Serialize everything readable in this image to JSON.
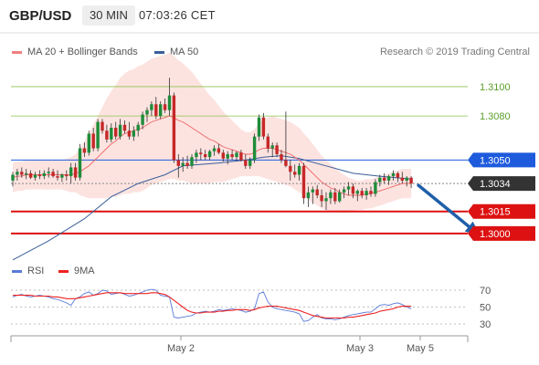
{
  "header": {
    "symbol": "GBP/USD",
    "timeframe": "30 MIN",
    "time": "07:03:26 CET"
  },
  "legend": {
    "items": [
      {
        "label": "MA 20 + Bollinger Bands",
        "color": "#f08080"
      },
      {
        "label": "MA 50",
        "color": "#3a5f9a"
      }
    ],
    "credit": "Research © 2019 Trading Central"
  },
  "rsi_legend": {
    "items": [
      {
        "label": "RSI",
        "color": "#5a7bd8"
      },
      {
        "label": "9MA",
        "color": "#ee2222"
      }
    ]
  },
  "chart_data": [
    {
      "type": "candlestick",
      "title": "GBP/USD",
      "ylim": [
        1.298,
        1.3118
      ],
      "x_tick_labels": [
        "May 2",
        "May 3",
        "May 5"
      ],
      "price_levels": [
        {
          "value": 1.31,
          "label": "1.3100",
          "kind": "resistance",
          "color": "#8bc34a"
        },
        {
          "value": 1.308,
          "label": "1.3080",
          "kind": "resistance",
          "color": "#8bc34a"
        },
        {
          "value": 1.305,
          "label": "1.3050",
          "kind": "pivot",
          "color": "#1e5bdc"
        },
        {
          "value": 1.3034,
          "label": "1.3034",
          "kind": "last",
          "color": "#333333"
        },
        {
          "value": 1.3015,
          "label": "1.3015",
          "kind": "support",
          "color": "#dd1111"
        },
        {
          "value": 1.3,
          "label": "1.3000",
          "kind": "support",
          "color": "#dd1111"
        }
      ],
      "candles": [
        [
          1.3036,
          1.3042,
          1.3032,
          1.304
        ],
        [
          1.304,
          1.3044,
          1.3036,
          1.3042
        ],
        [
          1.3042,
          1.3045,
          1.3038,
          1.304
        ],
        [
          1.304,
          1.3044,
          1.3037,
          1.3041
        ],
        [
          1.3041,
          1.3043,
          1.3037,
          1.3038
        ],
        [
          1.3038,
          1.3042,
          1.3036,
          1.304
        ],
        [
          1.304,
          1.3043,
          1.3037,
          1.3039
        ],
        [
          1.3039,
          1.3043,
          1.3037,
          1.3041
        ],
        [
          1.3041,
          1.3045,
          1.3038,
          1.3042
        ],
        [
          1.3042,
          1.3044,
          1.3038,
          1.3039
        ],
        [
          1.3039,
          1.3043,
          1.3036,
          1.3038
        ],
        [
          1.3038,
          1.3041,
          1.3035,
          1.304
        ],
        [
          1.304,
          1.3043,
          1.3036,
          1.3039
        ],
        [
          1.3039,
          1.3048,
          1.3034,
          1.3045
        ],
        [
          1.3045,
          1.3048,
          1.3036,
          1.3038
        ],
        [
          1.3038,
          1.3061,
          1.3036,
          1.3058
        ],
        [
          1.3058,
          1.3062,
          1.3052,
          1.3055
        ],
        [
          1.3055,
          1.307,
          1.3053,
          1.3068
        ],
        [
          1.3068,
          1.3072,
          1.3056,
          1.3058
        ],
        [
          1.3058,
          1.3078,
          1.3056,
          1.3076
        ],
        [
          1.3076,
          1.3078,
          1.3068,
          1.307
        ],
        [
          1.307,
          1.3074,
          1.3062,
          1.3064
        ],
        [
          1.3064,
          1.3075,
          1.3062,
          1.3072
        ],
        [
          1.3072,
          1.3076,
          1.3064,
          1.3066
        ],
        [
          1.3066,
          1.3078,
          1.3064,
          1.3074
        ],
        [
          1.3074,
          1.3077,
          1.3068,
          1.307
        ],
        [
          1.307,
          1.3076,
          1.3064,
          1.3066
        ],
        [
          1.3066,
          1.3073,
          1.3063,
          1.307
        ],
        [
          1.307,
          1.3076,
          1.3066,
          1.3074
        ],
        [
          1.3074,
          1.3083,
          1.3071,
          1.3081
        ],
        [
          1.3081,
          1.3086,
          1.3076,
          1.3084
        ],
        [
          1.3084,
          1.309,
          1.308,
          1.3088
        ],
        [
          1.3088,
          1.3093,
          1.3078,
          1.308
        ],
        [
          1.308,
          1.309,
          1.3078,
          1.3088
        ],
        [
          1.3088,
          1.3092,
          1.3082,
          1.3084
        ],
        [
          1.3084,
          1.3106,
          1.308,
          1.3094
        ],
        [
          1.3094,
          1.3096,
          1.3048,
          1.305
        ],
        [
          1.305,
          1.3054,
          1.3038,
          1.3046
        ],
        [
          1.3046,
          1.3052,
          1.3042,
          1.3048
        ],
        [
          1.3048,
          1.3053,
          1.3044,
          1.3046
        ],
        [
          1.3046,
          1.3054,
          1.3044,
          1.3052
        ],
        [
          1.3052,
          1.3057,
          1.3048,
          1.3055
        ],
        [
          1.3055,
          1.3058,
          1.305,
          1.3054
        ],
        [
          1.3054,
          1.3057,
          1.305,
          1.3052
        ],
        [
          1.3052,
          1.3057,
          1.305,
          1.3056
        ],
        [
          1.3056,
          1.306,
          1.3053,
          1.3058
        ],
        [
          1.3058,
          1.3061,
          1.3054,
          1.3055
        ],
        [
          1.3055,
          1.3057,
          1.3049,
          1.3051
        ],
        [
          1.3051,
          1.3056,
          1.3047,
          1.3054
        ],
        [
          1.3054,
          1.3057,
          1.305,
          1.3052
        ],
        [
          1.3052,
          1.3056,
          1.3049,
          1.3055
        ],
        [
          1.3055,
          1.3057,
          1.3049,
          1.305
        ],
        [
          1.305,
          1.3054,
          1.3044,
          1.3046
        ],
        [
          1.3046,
          1.3052,
          1.3044,
          1.305
        ],
        [
          1.305,
          1.3068,
          1.3048,
          1.3066
        ],
        [
          1.3066,
          1.3081,
          1.3063,
          1.3079
        ],
        [
          1.3079,
          1.3082,
          1.3064,
          1.3066
        ],
        [
          1.3066,
          1.3068,
          1.3055,
          1.3058
        ],
        [
          1.3058,
          1.3062,
          1.3052,
          1.306
        ],
        [
          1.306,
          1.3062,
          1.3052,
          1.3054
        ],
        [
          1.3054,
          1.3057,
          1.3048,
          1.305
        ],
        [
          1.305,
          1.3083,
          1.3045,
          1.3046
        ],
        [
          1.3046,
          1.305,
          1.3036,
          1.3042
        ],
        [
          1.3042,
          1.3047,
          1.3038,
          1.304
        ],
        [
          1.304,
          1.3048,
          1.3036,
          1.3046
        ],
        [
          1.3046,
          1.3048,
          1.302,
          1.3024
        ],
        [
          1.3024,
          1.3032,
          1.3018,
          1.3028
        ],
        [
          1.3028,
          1.3032,
          1.302,
          1.303
        ],
        [
          1.303,
          1.3033,
          1.3024,
          1.3026
        ],
        [
          1.3026,
          1.303,
          1.3018,
          1.3022
        ],
        [
          1.3022,
          1.3028,
          1.3016,
          1.3024
        ],
        [
          1.3024,
          1.303,
          1.302,
          1.3028
        ],
        [
          1.3028,
          1.3031,
          1.302,
          1.3022
        ],
        [
          1.3022,
          1.303,
          1.3021,
          1.3028
        ],
        [
          1.3028,
          1.3032,
          1.3024,
          1.303
        ],
        [
          1.303,
          1.3035,
          1.3026,
          1.3032
        ],
        [
          1.3032,
          1.3034,
          1.3024,
          1.3027
        ],
        [
          1.3027,
          1.303,
          1.3022,
          1.3029
        ],
        [
          1.3029,
          1.3031,
          1.3024,
          1.3026
        ],
        [
          1.3026,
          1.3031,
          1.3023,
          1.3029
        ],
        [
          1.3029,
          1.3032,
          1.3025,
          1.3027
        ],
        [
          1.3027,
          1.3037,
          1.3025,
          1.3035
        ],
        [
          1.3035,
          1.304,
          1.3032,
          1.3038
        ],
        [
          1.3038,
          1.3041,
          1.3034,
          1.3036
        ],
        [
          1.3036,
          1.304,
          1.3033,
          1.3039
        ],
        [
          1.3039,
          1.3043,
          1.3036,
          1.3041
        ],
        [
          1.3041,
          1.3042,
          1.3035,
          1.3038
        ],
        [
          1.3038,
          1.3042,
          1.3034,
          1.3036
        ],
        [
          1.3036,
          1.3039,
          1.3032,
          1.3038
        ],
        [
          1.3038,
          1.3039,
          1.3031,
          1.3034
        ]
      ],
      "ma20": [
        1.3038,
        1.3039,
        1.3039,
        1.304,
        1.304,
        1.304,
        1.304,
        1.304,
        1.304,
        1.304,
        1.304,
        1.304,
        1.304,
        1.304,
        1.3041,
        1.3042,
        1.3044,
        1.3046,
        1.3049,
        1.3052,
        1.3055,
        1.3058,
        1.3061,
        1.3063,
        1.3066,
        1.3068,
        1.3069,
        1.307,
        1.3071,
        1.3072,
        1.3074,
        1.3076,
        1.3077,
        1.3078,
        1.3079,
        1.308,
        1.3079,
        1.3077,
        1.3076,
        1.3074,
        1.3072,
        1.307,
        1.3068,
        1.3066,
        1.3064,
        1.3063,
        1.3061,
        1.3059,
        1.3058,
        1.3057,
        1.3056,
        1.3055,
        1.3054,
        1.3054,
        1.3055,
        1.3057,
        1.3058,
        1.3058,
        1.3058,
        1.3057,
        1.3056,
        1.3055,
        1.3054,
        1.3052,
        1.305,
        1.3047,
        1.3044,
        1.3041,
        1.3038,
        1.3035,
        1.3033,
        1.3031,
        1.303,
        1.3028,
        1.3027,
        1.3026,
        1.3026,
        1.3026,
        1.3026,
        1.3027,
        1.3027,
        1.3028,
        1.3029,
        1.303,
        1.3031,
        1.3032,
        1.3033,
        1.3034,
        1.3034,
        1.3034
      ],
      "bb_width": [
        0.001,
        0.001,
        0.001,
        0.001,
        0.001,
        0.001,
        0.001,
        0.001,
        0.001,
        0.001,
        0.001,
        0.001,
        0.0011,
        0.0012,
        0.0013,
        0.0016,
        0.0019,
        0.0022,
        0.0025,
        0.0028,
        0.0031,
        0.0034,
        0.0036,
        0.0038,
        0.004,
        0.0041,
        0.0042,
        0.0042,
        0.0043,
        0.0043,
        0.0043,
        0.0043,
        0.0043,
        0.0043,
        0.0043,
        0.0043,
        0.0042,
        0.0041,
        0.004,
        0.0039,
        0.0038,
        0.0036,
        0.0034,
        0.0032,
        0.003,
        0.0028,
        0.0026,
        0.0024,
        0.0022,
        0.002,
        0.0018,
        0.0016,
        0.0015,
        0.0015,
        0.0016,
        0.0018,
        0.002,
        0.0021,
        0.0022,
        0.0022,
        0.0022,
        0.0022,
        0.0022,
        0.0022,
        0.0022,
        0.0021,
        0.0021,
        0.002,
        0.0019,
        0.0018,
        0.0017,
        0.0016,
        0.0015,
        0.0014,
        0.0013,
        0.0012,
        0.0011,
        0.001,
        0.001,
        0.001,
        0.001,
        0.001,
        0.001,
        0.001,
        0.001,
        0.001,
        0.001,
        0.001,
        0.001,
        0.001
      ],
      "ma50": [
        [
          0,
          1.2982
        ],
        [
          8,
          1.2995
        ],
        [
          16,
          1.301
        ],
        [
          22,
          1.3025
        ],
        [
          28,
          1.3034
        ],
        [
          34,
          1.304
        ],
        [
          38,
          1.3046
        ],
        [
          46,
          1.3048
        ],
        [
          52,
          1.305
        ],
        [
          56,
          1.3052
        ],
        [
          60,
          1.3053
        ],
        [
          64,
          1.3051
        ],
        [
          70,
          1.3046
        ],
        [
          76,
          1.3041
        ],
        [
          82,
          1.3039
        ],
        [
          89,
          1.3037
        ]
      ],
      "forecast_arrow": {
        "from": [
          89,
          1.3034
        ],
        "to": [
          105,
          1.3
        ]
      }
    },
    {
      "type": "line",
      "title": "RSI",
      "ylim": [
        20,
        80
      ],
      "y_ticks": [
        30,
        50,
        70
      ],
      "series": [
        {
          "name": "RSI",
          "color": "#5a7bd8",
          "values": [
            62,
            64,
            65,
            63,
            62,
            63,
            64,
            63,
            62,
            60,
            59,
            57,
            55,
            52,
            60,
            62,
            66,
            68,
            64,
            66,
            70,
            69,
            65,
            66,
            67,
            65,
            63,
            64,
            66,
            68,
            70,
            71,
            70,
            64,
            63,
            62,
            38,
            37,
            38,
            39,
            40,
            43,
            44,
            45,
            44,
            45,
            47,
            46,
            47,
            48,
            47,
            46,
            44,
            45,
            48,
            66,
            68,
            56,
            50,
            48,
            47,
            46,
            45,
            44,
            42,
            33,
            34,
            38,
            41,
            37,
            36,
            36,
            35,
            36,
            38,
            40,
            41,
            42,
            43,
            44,
            44,
            48,
            52,
            53,
            52,
            54,
            55,
            53,
            50,
            48
          ]
        },
        {
          "name": "9MA",
          "color": "#ee2222",
          "values": [
            64,
            64,
            64,
            64,
            64,
            63,
            63,
            63,
            63,
            62,
            62,
            61,
            60,
            60,
            60,
            61,
            62,
            63,
            64,
            65,
            66,
            67,
            67,
            67,
            67,
            66,
            66,
            66,
            66,
            66,
            66,
            67,
            67,
            66,
            65,
            62,
            58,
            54,
            50,
            46,
            44,
            43,
            43,
            44,
            44,
            44,
            45,
            45,
            46,
            46,
            47,
            47,
            47,
            46,
            47,
            49,
            50,
            51,
            51,
            51,
            50,
            49,
            48,
            47,
            46,
            44,
            42,
            40,
            39,
            38,
            37,
            37,
            37,
            37,
            37,
            38,
            38,
            39,
            40,
            41,
            42,
            43,
            45,
            46,
            47,
            48,
            50,
            51,
            51,
            51
          ]
        }
      ]
    }
  ]
}
